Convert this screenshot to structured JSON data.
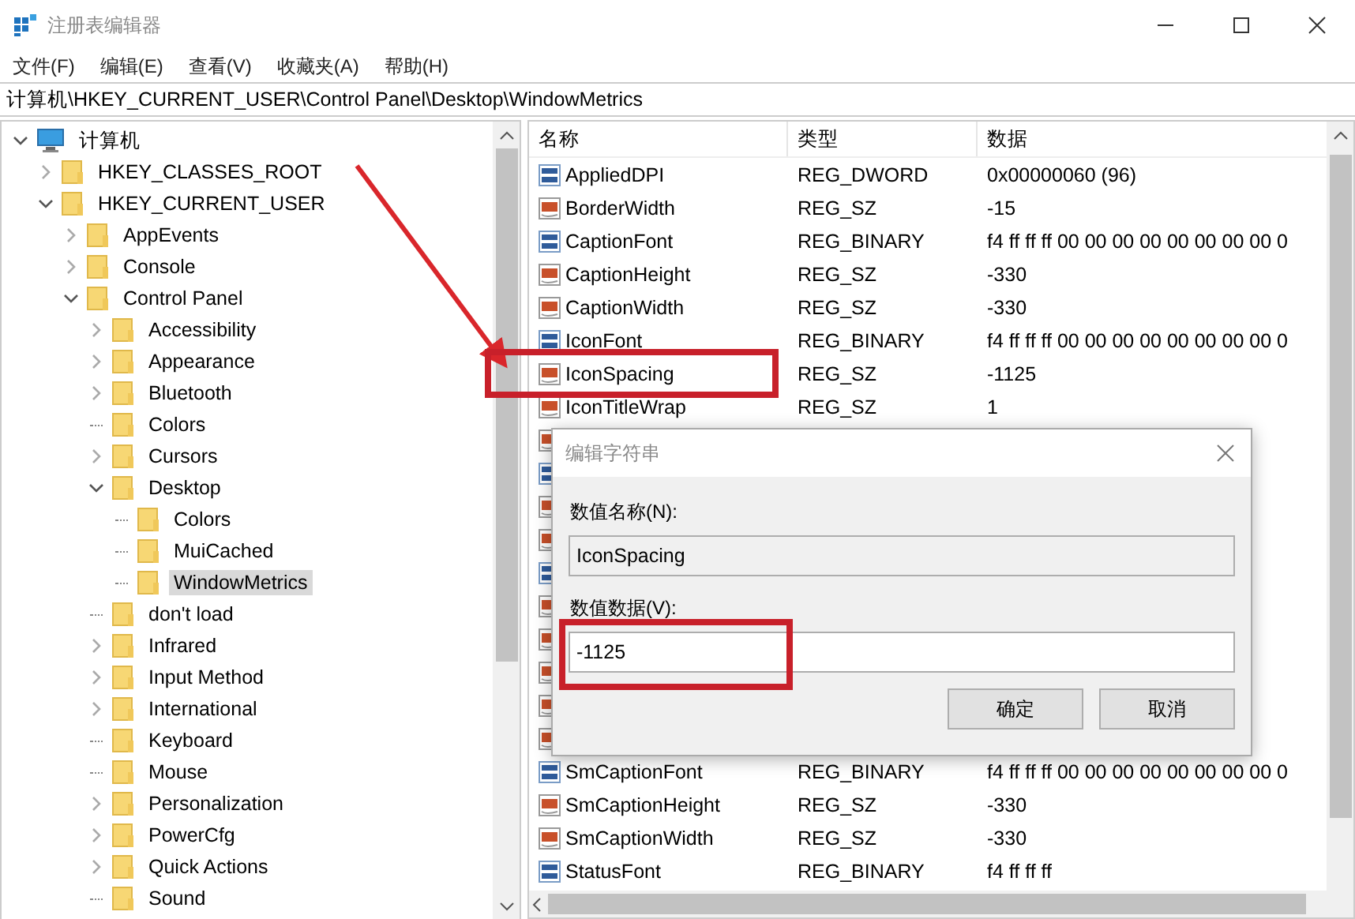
{
  "window": {
    "title": "注册表编辑器"
  },
  "menu": [
    "文件(F)",
    "编辑(E)",
    "查看(V)",
    "收藏夹(A)",
    "帮助(H)"
  ],
  "address": "计算机\\HKEY_CURRENT_USER\\Control Panel\\Desktop\\WindowMetrics",
  "tree": [
    {
      "label": "计算机",
      "kind": "computer",
      "expanded": true,
      "selected": false,
      "children": [
        {
          "label": "HKEY_CLASSES_ROOT",
          "kind": "folder",
          "expanded": false,
          "selected": false
        },
        {
          "label": "HKEY_CURRENT_USER",
          "kind": "folder",
          "expanded": true,
          "selected": false,
          "children": [
            {
              "label": "AppEvents",
              "kind": "folder",
              "expanded": false,
              "selected": false
            },
            {
              "label": "Console",
              "kind": "folder",
              "expanded": false,
              "selected": false
            },
            {
              "label": "Control Panel",
              "kind": "folder",
              "expanded": true,
              "selected": false,
              "children": [
                {
                  "label": "Accessibility",
                  "kind": "folder",
                  "expanded": false,
                  "selected": false
                },
                {
                  "label": "Appearance",
                  "kind": "folder",
                  "expanded": false,
                  "selected": false
                },
                {
                  "label": "Bluetooth",
                  "kind": "folder",
                  "expanded": false,
                  "selected": false
                },
                {
                  "label": "Colors",
                  "kind": "leaf",
                  "selected": false
                },
                {
                  "label": "Cursors",
                  "kind": "folder",
                  "expanded": false,
                  "selected": false
                },
                {
                  "label": "Desktop",
                  "kind": "folder",
                  "expanded": true,
                  "selected": false,
                  "children": [
                    {
                      "label": "Colors",
                      "kind": "leaf",
                      "selected": false
                    },
                    {
                      "label": "MuiCached",
                      "kind": "leaf",
                      "selected": false
                    },
                    {
                      "label": "WindowMetrics",
                      "kind": "leaf",
                      "selected": true
                    }
                  ]
                },
                {
                  "label": "don't load",
                  "kind": "leaf",
                  "selected": false
                },
                {
                  "label": "Infrared",
                  "kind": "folder",
                  "expanded": false,
                  "selected": false
                },
                {
                  "label": "Input Method",
                  "kind": "folder",
                  "expanded": false,
                  "selected": false
                },
                {
                  "label": "International",
                  "kind": "folder",
                  "expanded": false,
                  "selected": false
                },
                {
                  "label": "Keyboard",
                  "kind": "leaf",
                  "selected": false
                },
                {
                  "label": "Mouse",
                  "kind": "leaf",
                  "selected": false
                },
                {
                  "label": "Personalization",
                  "kind": "folder",
                  "expanded": false,
                  "selected": false
                },
                {
                  "label": "PowerCfg",
                  "kind": "folder",
                  "expanded": false,
                  "selected": false
                },
                {
                  "label": "Quick Actions",
                  "kind": "folder",
                  "expanded": false,
                  "selected": false
                },
                {
                  "label": "Sound",
                  "kind": "leaf",
                  "selected": false
                }
              ]
            }
          ]
        }
      ]
    }
  ],
  "table": {
    "columns": [
      "名称",
      "类型",
      "数据"
    ],
    "rows": [
      {
        "kind": "binary",
        "name": "AppliedDPI",
        "type": "REG_DWORD",
        "data": "0x00000060 (96)"
      },
      {
        "kind": "string",
        "name": "BorderWidth",
        "type": "REG_SZ",
        "data": "-15"
      },
      {
        "kind": "binary",
        "name": "CaptionFont",
        "type": "REG_BINARY",
        "data": "f4 ff ff ff 00 00 00 00 00 00 00 00 0"
      },
      {
        "kind": "string",
        "name": "CaptionHeight",
        "type": "REG_SZ",
        "data": "-330"
      },
      {
        "kind": "string",
        "name": "CaptionWidth",
        "type": "REG_SZ",
        "data": "-330"
      },
      {
        "kind": "binary",
        "name": "IconFont",
        "type": "REG_BINARY",
        "data": "f4 ff ff ff 00 00 00 00 00 00 00 00 0"
      },
      {
        "kind": "string",
        "name": "IconSpacing",
        "type": "REG_SZ",
        "data": "-1125"
      },
      {
        "kind": "string",
        "name": "IconTitleWrap",
        "type": "REG_SZ",
        "data": "1"
      },
      {
        "kind": "string"
      },
      {
        "kind": "binary"
      },
      {
        "kind": "string"
      },
      {
        "kind": "string"
      },
      {
        "kind": "binary"
      },
      {
        "kind": "string"
      },
      {
        "kind": "string"
      },
      {
        "kind": "string"
      },
      {
        "kind": "string"
      },
      {
        "kind": "string"
      },
      {
        "kind": "binary",
        "name": "SmCaptionFont",
        "type": "REG_BINARY",
        "data": "f4 ff ff ff 00 00 00 00 00 00 00 00 0"
      },
      {
        "kind": "string",
        "name": "SmCaptionHeight",
        "type": "REG_SZ",
        "data": "-330"
      },
      {
        "kind": "string",
        "name": "SmCaptionWidth",
        "type": "REG_SZ",
        "data": "-330"
      },
      {
        "kind": "binary",
        "name": "StatusFont",
        "type": "REG_BINARY",
        "data": "f4 ff ff ff"
      }
    ]
  },
  "dialog": {
    "title": "编辑字符串",
    "name_label": "数值名称(N):",
    "name_value": "IconSpacing",
    "data_label": "数值数据(V):",
    "data_value": "-1125",
    "buttons": [
      "确定",
      "取消"
    ]
  }
}
